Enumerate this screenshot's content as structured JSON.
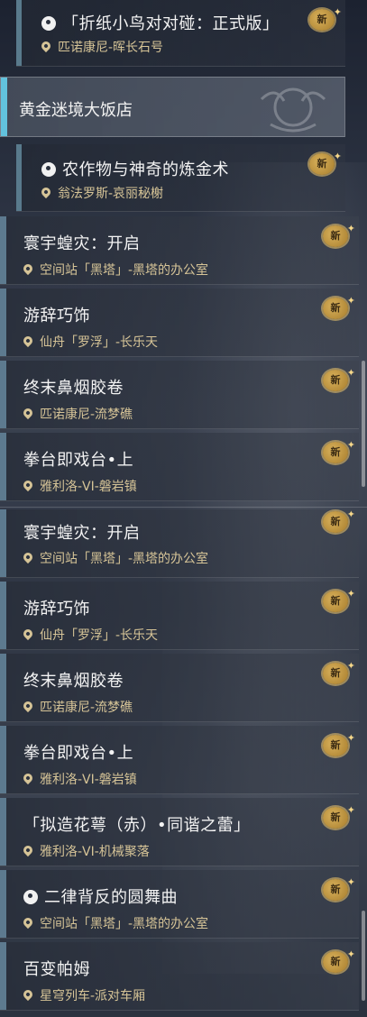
{
  "top_entry": {
    "title": "「折纸小鸟对对碰：正式版」",
    "location": "匹诺康尼-晖长石号",
    "badge": "新"
  },
  "section": {
    "title": "黄金迷境大饭店"
  },
  "indent_entry": {
    "title": "农作物与神奇的炼金术",
    "location": "翁法罗斯-哀丽秘榭",
    "badge": "新"
  },
  "list_a": [
    {
      "title": "寰宇蝗灾：开启",
      "location": "空间站「黑塔」-黑塔的办公室",
      "badge": "新"
    },
    {
      "title": "游辞巧饰",
      "location": "仙舟「罗浮」-长乐天",
      "badge": "新"
    },
    {
      "title": "终末鼻烟胶卷",
      "location": "匹诺康尼-流梦礁",
      "badge": "新"
    },
    {
      "title": "拳台即戏台•上",
      "location": "雅利洛-VI-磐岩镇",
      "badge": "新"
    }
  ],
  "list_b": [
    {
      "title": "寰宇蝗灾：开启",
      "location": "空间站「黑塔」-黑塔的办公室",
      "badge": "新"
    },
    {
      "title": "游辞巧饰",
      "location": "仙舟「罗浮」-长乐天",
      "badge": "新"
    },
    {
      "title": "终末鼻烟胶卷",
      "location": "匹诺康尼-流梦礁",
      "badge": "新"
    },
    {
      "title": "拳台即戏台•上",
      "location": "雅利洛-VI-磐岩镇",
      "badge": "新"
    },
    {
      "title": "「拟造花萼（赤）•同谐之蕾」",
      "location": "雅利洛-VI-机械聚落",
      "badge": "新"
    },
    {
      "title": "二律背反的圆舞曲",
      "location": "空间站「黑塔」-黑塔的办公室",
      "badge": "新"
    },
    {
      "title": "百变帕姆",
      "location": "星穹列车-派对车厢",
      "badge": "新"
    }
  ]
}
